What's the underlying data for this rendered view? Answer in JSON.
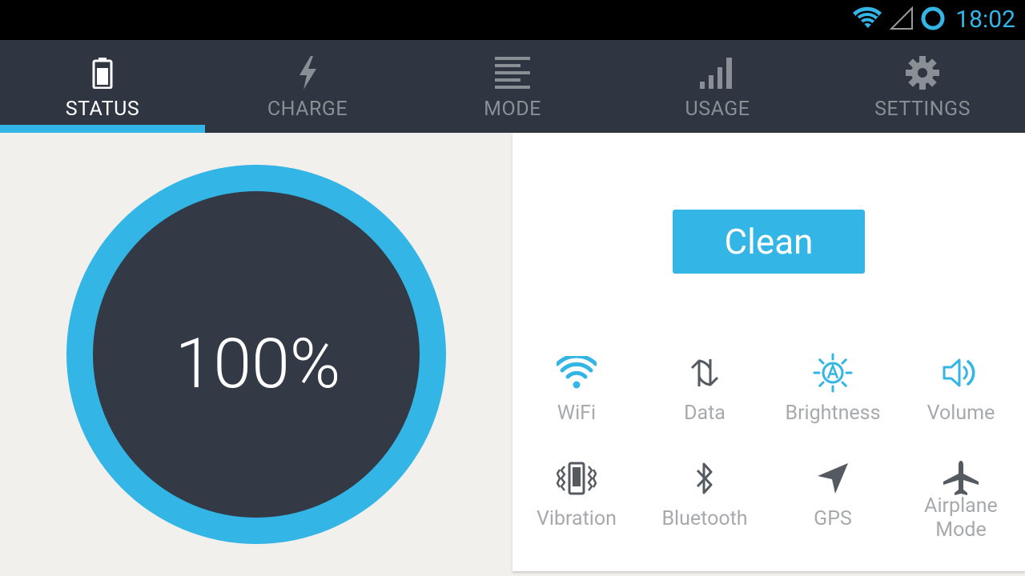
{
  "status_bar": {
    "time": "18:02",
    "icons": [
      "wifi-signal-icon",
      "cell-signal-icon",
      "sync-ring-icon"
    ]
  },
  "tabs": [
    {
      "label": "STATUS",
      "icon": "battery-icon",
      "active": true
    },
    {
      "label": "CHARGE",
      "icon": "lightning-icon",
      "active": false
    },
    {
      "label": "MODE",
      "icon": "list-icon",
      "active": false
    },
    {
      "label": "USAGE",
      "icon": "bar-chart-icon",
      "active": false
    },
    {
      "label": "SETTINGS",
      "icon": "gear-icon",
      "active": false
    }
  ],
  "battery": {
    "level_text": "100%",
    "level": 100
  },
  "clean_button": {
    "label": "Clean"
  },
  "toggles": [
    {
      "label": "WiFi",
      "icon": "wifi-icon",
      "on": true
    },
    {
      "label": "Data",
      "icon": "data-transfer-icon",
      "on": false
    },
    {
      "label": "Brightness",
      "icon": "brightness-auto-icon",
      "on": true
    },
    {
      "label": "Volume",
      "icon": "volume-icon",
      "on": true
    },
    {
      "label": "Vibration",
      "icon": "vibration-icon",
      "on": false
    },
    {
      "label": "Bluetooth",
      "icon": "bluetooth-icon",
      "on": false
    },
    {
      "label": "GPS",
      "icon": "gps-arrow-icon",
      "on": false
    },
    {
      "label": "Airplane Mode",
      "icon": "airplane-icon",
      "on": false
    }
  ],
  "colors": {
    "accent": "#33b5e5",
    "tab_bar": "#2f3641",
    "gauge_core": "#333a45",
    "icon_off": "#555a60",
    "label": "#a7a9ac"
  }
}
